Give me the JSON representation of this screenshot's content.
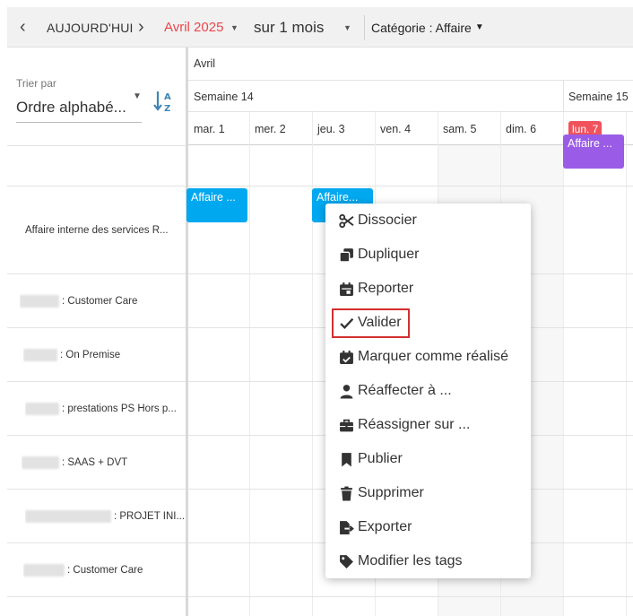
{
  "toolbar": {
    "today_label": "AUJOURD'HUI",
    "month_label": "Avril 2025",
    "month_color": "#e9484d",
    "span_label": "sur 1 mois",
    "category_label": "Catégorie : Affaire"
  },
  "sidebar": {
    "sort_label": "Trier par",
    "sort_value": "Ordre alphabé..."
  },
  "timeline": {
    "month": "Avril",
    "weeks": [
      "Semaine 14",
      "Semaine 15"
    ],
    "days": [
      "mar. 1",
      "mer. 2",
      "jeu. 3",
      "ven. 4",
      "sam. 5",
      "dim. 6"
    ],
    "today": "lun. 7"
  },
  "rows": [
    {
      "label": ""
    },
    {
      "label": "Affaire interne des services R..."
    },
    {
      "label": ": Customer Care"
    },
    {
      "label": ": On Premise"
    },
    {
      "label": ": prestations PS Hors p..."
    },
    {
      "label": ": SAAS + DVT"
    },
    {
      "label": ": PROJET INI..."
    },
    {
      "label": ": Customer Care"
    }
  ],
  "events": [
    {
      "label": "Affaire ..."
    },
    {
      "label": "Affaire..."
    },
    {
      "label": "Affaire ..."
    }
  ],
  "colors": {
    "event_blue": "#00a8f0",
    "event_purple": "#9a5ce6",
    "today_badge": "#f0525c",
    "highlight": "#d32f2f"
  },
  "context_menu": {
    "items": [
      {
        "label": "Dissocier",
        "icon": "scissors-icon"
      },
      {
        "label": "Dupliquer",
        "icon": "copy-icon"
      },
      {
        "label": "Reporter",
        "icon": "calendar-icon"
      },
      {
        "label": "Valider",
        "icon": "check-icon"
      },
      {
        "label": "Marquer comme réalisé",
        "icon": "calendar-check-icon"
      },
      {
        "label": "Réaffecter à ...",
        "icon": "user-icon"
      },
      {
        "label": "Réassigner sur ...",
        "icon": "briefcase-icon"
      },
      {
        "label": "Publier",
        "icon": "bookmark-icon"
      },
      {
        "label": "Supprimer",
        "icon": "trash-icon"
      },
      {
        "label": "Exporter",
        "icon": "file-export-icon"
      },
      {
        "label": "Modifier les tags",
        "icon": "tag-icon"
      }
    ]
  }
}
